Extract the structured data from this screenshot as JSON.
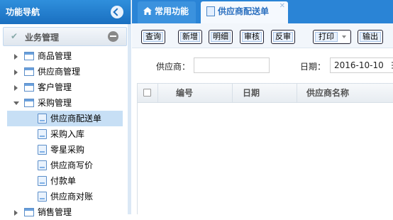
{
  "nav": {
    "title": "功能导航",
    "module": "业务管理",
    "tree": [
      {
        "label": "商品管理",
        "level": 0,
        "expanded": false
      },
      {
        "label": "供应商管理",
        "level": 0,
        "expanded": false
      },
      {
        "label": "客户管理",
        "level": 0,
        "expanded": false
      },
      {
        "label": "采购管理",
        "level": 0,
        "expanded": true
      },
      {
        "label": "供应商配送单",
        "level": 1,
        "selected": true
      },
      {
        "label": "采购入库",
        "level": 1
      },
      {
        "label": "零星采购",
        "level": 1
      },
      {
        "label": "供应商写价",
        "level": 1
      },
      {
        "label": "付款单",
        "level": 1
      },
      {
        "label": "供应商对账",
        "level": 1
      },
      {
        "label": "销售管理",
        "level": 0,
        "expanded": false
      }
    ]
  },
  "tabs": [
    {
      "label": "常用功能"
    },
    {
      "label": "供应商配送单",
      "active": true
    }
  ],
  "toolbar": {
    "query": "查询",
    "add": "新增",
    "detail": "明细",
    "audit": "审核",
    "unaudit": "反审",
    "print": "打印",
    "export": "输出"
  },
  "filter": {
    "supplier_label": "供应商：",
    "supplier_value": "",
    "date_label": "日期：",
    "date_value": "2016-10-10"
  },
  "grid": {
    "columns": [
      "编号",
      "日期",
      "供应商名称"
    ],
    "rows": []
  },
  "colors": {
    "header_blue": "#2a84d6",
    "selection": "#c7dff5"
  }
}
